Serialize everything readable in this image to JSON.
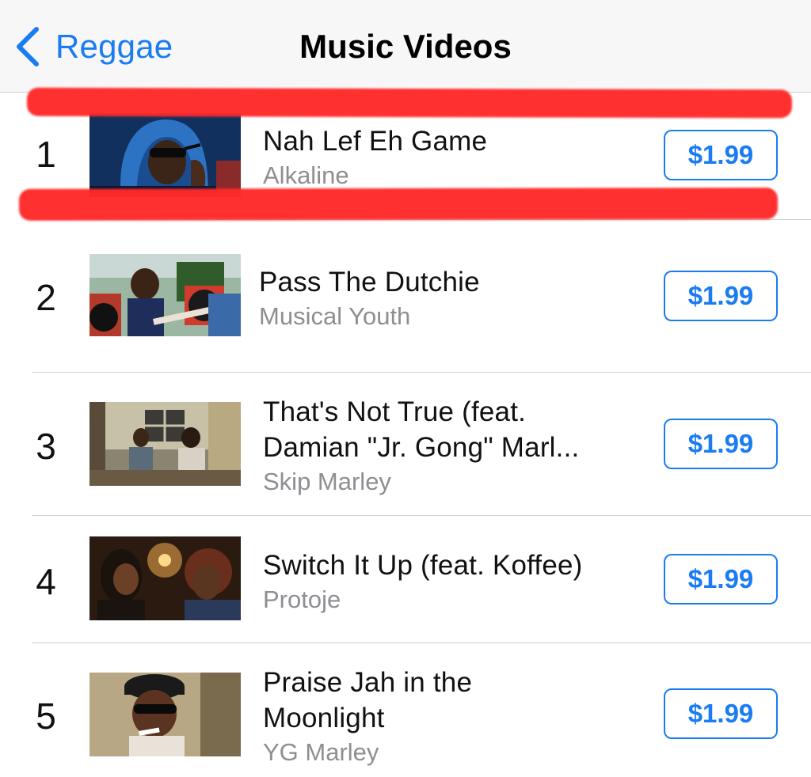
{
  "nav": {
    "back_label": "Reggae",
    "title": "Music Videos"
  },
  "colors": {
    "accent": "#1a7cf2",
    "highlight": "#ff2a2a",
    "secondary_text": "#8e8e93"
  },
  "videos": [
    {
      "rank": "1",
      "title_line1": "Nah Lef Eh Game",
      "title_line2": "",
      "artist": "Alkaline",
      "price": "$1.99"
    },
    {
      "rank": "2",
      "title_line1": "Pass The Dutchie",
      "title_line2": "",
      "artist": "Musical Youth",
      "price": "$1.99"
    },
    {
      "rank": "3",
      "title_line1": "That's Not True (feat.",
      "title_line2": "Damian \"Jr. Gong\" Marl...",
      "artist": "Skip Marley",
      "price": "$1.99"
    },
    {
      "rank": "4",
      "title_line1": "Switch It Up (feat. Koffee)",
      "title_line2": "",
      "artist": "Protoje",
      "price": "$1.99"
    },
    {
      "rank": "5",
      "title_line1": "Praise Jah in the",
      "title_line2": "Moonlight",
      "artist": "YG Marley",
      "price": "$1.99"
    }
  ]
}
